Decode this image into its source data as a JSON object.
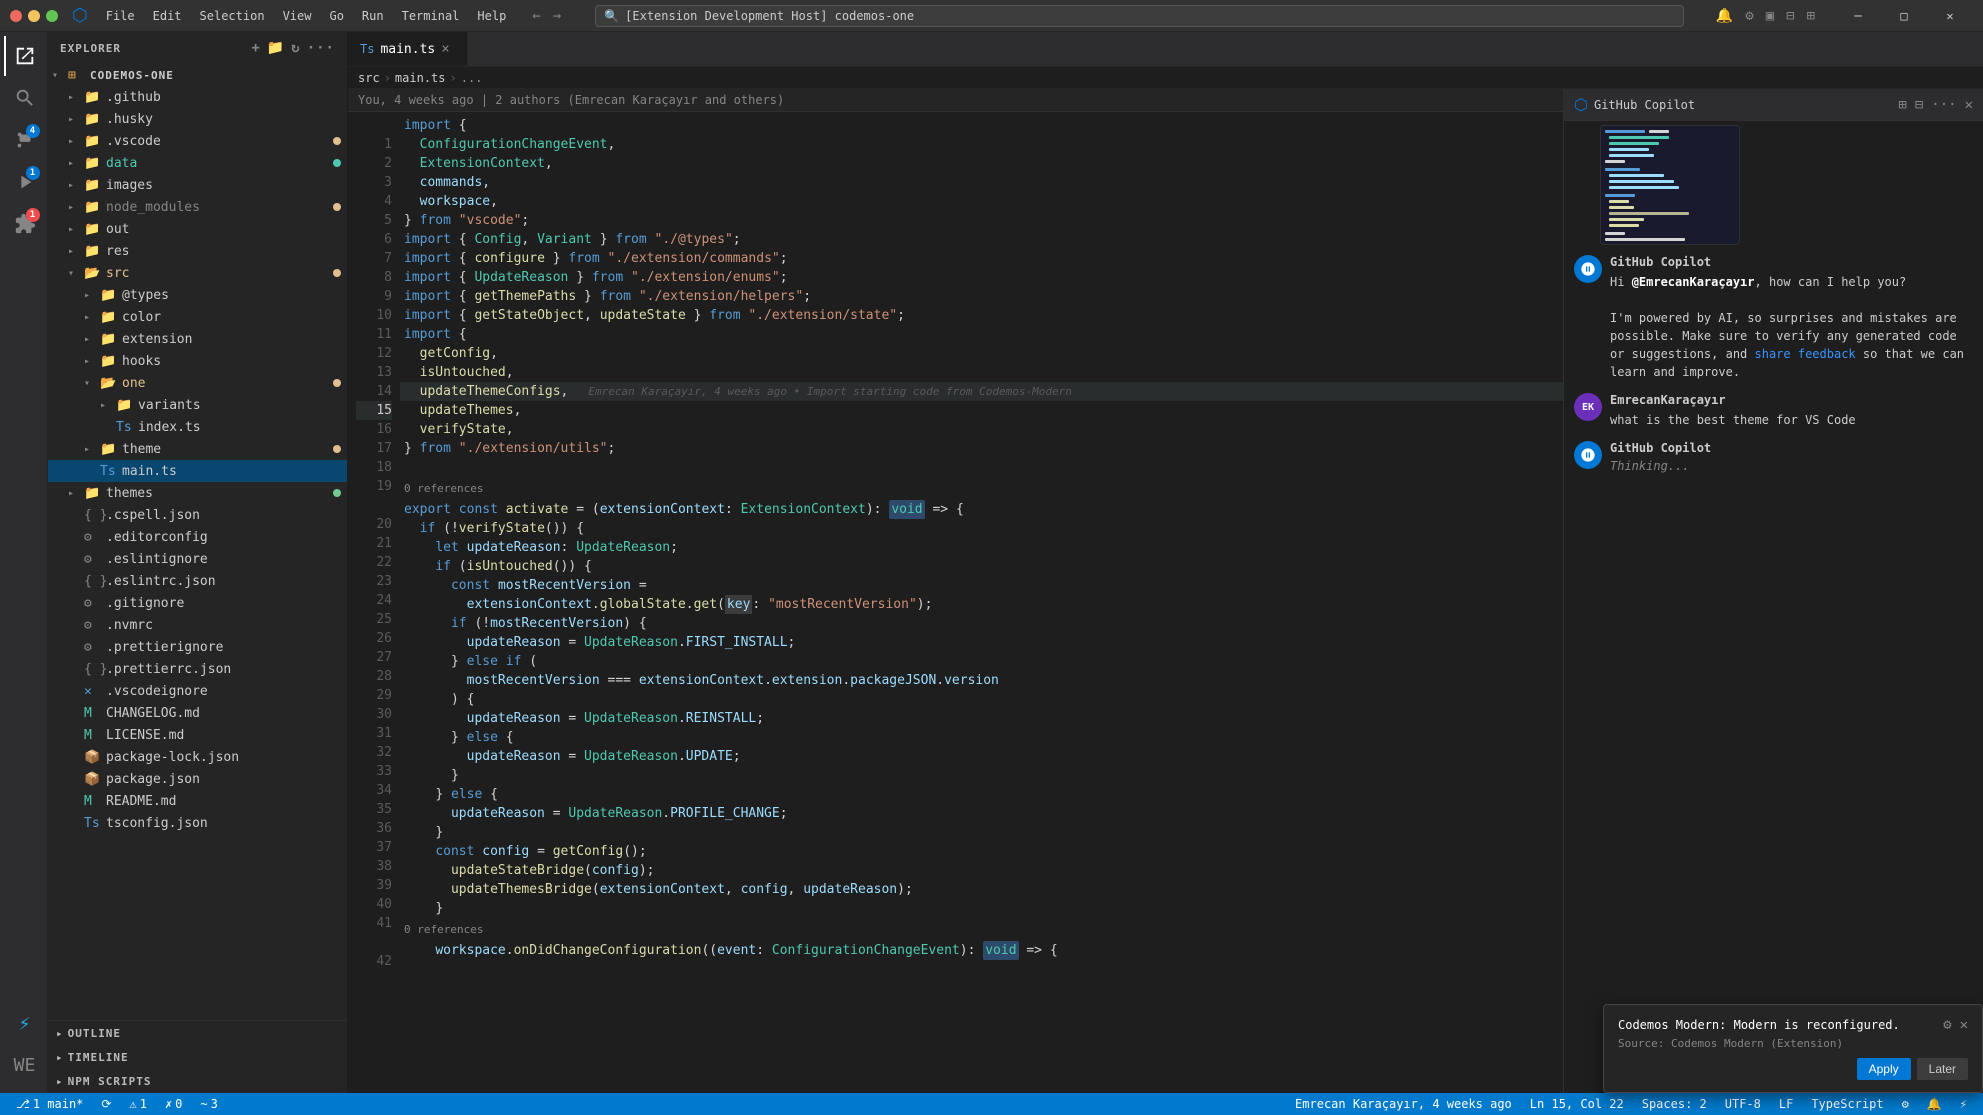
{
  "titleBar": {
    "searchText": "[Extension Development Host] codemos-one",
    "menuItems": [
      "File",
      "Edit",
      "Selection",
      "View",
      "Go",
      "Run",
      "Terminal",
      "Help"
    ]
  },
  "sidebar": {
    "title": "EXPLORER",
    "projectName": "CODEMOS-ONE",
    "headerIcons": [
      "...",
      "☰"
    ],
    "items": [
      {
        "label": ".github",
        "type": "folder",
        "icon": "📁",
        "indent": 1
      },
      {
        "label": ".husky",
        "type": "folder",
        "icon": "📁",
        "indent": 1
      },
      {
        "label": ".vscode",
        "type": "folder",
        "icon": "📁",
        "indent": 1,
        "dot": "yellow"
      },
      {
        "label": "data",
        "type": "folder",
        "icon": "📁",
        "indent": 1,
        "dot": "blue",
        "color": "#4ec9b0"
      },
      {
        "label": "images",
        "type": "folder",
        "icon": "📁",
        "indent": 1
      },
      {
        "label": "node_modules",
        "type": "folder",
        "icon": "📁",
        "indent": 1,
        "dot": "yellow"
      },
      {
        "label": "out",
        "type": "folder",
        "icon": "📁",
        "indent": 1
      },
      {
        "label": "res",
        "type": "folder",
        "icon": "📁",
        "indent": 1
      },
      {
        "label": "src",
        "type": "folder",
        "icon": "📁",
        "indent": 1,
        "dot": "yellow",
        "open": true
      },
      {
        "label": "@types",
        "type": "folder",
        "icon": "📁",
        "indent": 2
      },
      {
        "label": "color",
        "type": "folder",
        "icon": "📁",
        "indent": 2
      },
      {
        "label": "extension",
        "type": "folder",
        "icon": "📁",
        "indent": 2
      },
      {
        "label": "hooks",
        "type": "folder",
        "icon": "📁",
        "indent": 2
      },
      {
        "label": "one",
        "type": "folder",
        "icon": "📁",
        "indent": 2,
        "dot": "yellow",
        "open": true
      },
      {
        "label": "variants",
        "type": "folder",
        "icon": "📁",
        "indent": 3
      },
      {
        "label": "index.ts",
        "type": "file",
        "icon": "🟦",
        "indent": 3
      },
      {
        "label": "theme",
        "type": "folder",
        "icon": "📁",
        "indent": 2,
        "dot": "yellow"
      },
      {
        "label": "main.ts",
        "type": "file",
        "icon": "🟦",
        "indent": 2,
        "active": true
      },
      {
        "label": "themes",
        "type": "folder",
        "icon": "📁",
        "indent": 1,
        "dot": "green"
      },
      {
        "label": ".cspell.json",
        "type": "file",
        "icon": "⚙️",
        "indent": 1
      },
      {
        "label": ".editorconfig",
        "type": "file",
        "icon": "⚙️",
        "indent": 1
      },
      {
        "label": ".eslintignore",
        "type": "file",
        "icon": "⚙️",
        "indent": 1
      },
      {
        "label": ".eslintrc.json",
        "type": "file",
        "icon": "⚙️",
        "indent": 1
      },
      {
        "label": ".gitignore",
        "type": "file",
        "icon": "⚙️",
        "indent": 1
      },
      {
        "label": ".nvmrc",
        "type": "file",
        "icon": "⚙️",
        "indent": 1
      },
      {
        "label": ".prettierignore",
        "type": "file",
        "icon": "⚙️",
        "indent": 1
      },
      {
        "label": ".prettierrc.json",
        "type": "file",
        "icon": "⚙️",
        "indent": 1
      },
      {
        "label": "vscodeignore",
        "type": "file",
        "icon": "⚙️",
        "indent": 1
      },
      {
        "label": "CHANGELOG.md",
        "type": "file",
        "icon": "📄",
        "indent": 1
      },
      {
        "label": "LICENSE.md",
        "type": "file",
        "icon": "📄",
        "indent": 1
      },
      {
        "label": "package-lock.json",
        "type": "file",
        "icon": "📦",
        "indent": 1
      },
      {
        "label": "package.json",
        "type": "file",
        "icon": "📦",
        "indent": 1
      },
      {
        "label": "README.md",
        "type": "file",
        "icon": "📄",
        "indent": 1
      },
      {
        "label": "tsconfig.json",
        "type": "file",
        "icon": "⚙️",
        "indent": 1
      }
    ],
    "bottomSections": [
      "OUTLINE",
      "TIMELINE",
      "NPM SCRIPTS"
    ]
  },
  "tabs": [
    {
      "label": "main.ts",
      "active": true,
      "icon": "🟦",
      "modified": false
    }
  ],
  "breadcrumb": [
    "src",
    ">",
    "main.ts",
    ">",
    "..."
  ],
  "git": {
    "blame": "Emrecan Karaçayır, 4 weeks ago • Import starting code from Codemos-Modern"
  },
  "codeLines": [
    {
      "num": "",
      "content": "You, 4 weeks ago | 2 authors (Emrecan Karaçayır and others)",
      "type": "blame"
    },
    {
      "num": "1",
      "content": "import {"
    },
    {
      "num": "2",
      "content": "  ConfigurationChangeEvent,"
    },
    {
      "num": "3",
      "content": "  ExtensionContext,"
    },
    {
      "num": "4",
      "content": "  commands,"
    },
    {
      "num": "5",
      "content": "  workspace,"
    },
    {
      "num": "6",
      "content": "} from \"vscode\";"
    },
    {
      "num": "7",
      "content": "import { Config, Variant } from \"./@types\";"
    },
    {
      "num": "8",
      "content": "import { configure } from \"./extension/commands\";"
    },
    {
      "num": "9",
      "content": "import { UpdateReason } from \"./extension/enums\";"
    },
    {
      "num": "10",
      "content": "import { getThemePaths } from \"./extension/helpers\";"
    },
    {
      "num": "11",
      "content": "import { getStateObject, updateState } from \"./extension/state\";"
    },
    {
      "num": "12",
      "content": "import {"
    },
    {
      "num": "13",
      "content": "  getConfig,"
    },
    {
      "num": "14",
      "content": "  isUntouched,"
    },
    {
      "num": "15",
      "content": "  updateThemeConfigs,",
      "active": true,
      "blame": "Emrecan Karaçayır, 4 weeks ago • Import starting code from Codemos-Modern"
    },
    {
      "num": "16",
      "content": "  updateThemes,"
    },
    {
      "num": "17",
      "content": "  verifyState,"
    },
    {
      "num": "18",
      "content": "} from \"./extension/utils\";"
    },
    {
      "num": "19",
      "content": ""
    },
    {
      "num": "",
      "content": "0 references",
      "type": "ref"
    },
    {
      "num": "20",
      "content": "export const activate = (extensionContext: ExtensionContext): void => {"
    },
    {
      "num": "21",
      "content": "  if (!verifyState()) {"
    },
    {
      "num": "22",
      "content": "    let updateReason: UpdateReason;"
    },
    {
      "num": "23",
      "content": "    if (isUntouched()) {"
    },
    {
      "num": "24",
      "content": "      const mostRecentVersion ="
    },
    {
      "num": "25",
      "content": "        extensionContext.globalState.get(key: \"mostRecentVersion\");"
    },
    {
      "num": "26",
      "content": "      if (!mostRecentVersion) {"
    },
    {
      "num": "27",
      "content": "        updateReason = UpdateReason.FIRST_INSTALL;"
    },
    {
      "num": "28",
      "content": "      } else if ("
    },
    {
      "num": "29",
      "content": "        mostRecentVersion === extensionContext.extension.packageJSON.version"
    },
    {
      "num": "30",
      "content": "      ) {"
    },
    {
      "num": "31",
      "content": "        updateReason = UpdateReason.REINSTALL;"
    },
    {
      "num": "32",
      "content": "      } else {"
    },
    {
      "num": "33",
      "content": "        updateReason = UpdateReason.UPDATE;"
    },
    {
      "num": "34",
      "content": "      }"
    },
    {
      "num": "35",
      "content": "    } else {"
    },
    {
      "num": "36",
      "content": "      updateReason = UpdateReason.PROFILE_CHANGE;"
    },
    {
      "num": "37",
      "content": "    }"
    },
    {
      "num": "38",
      "content": "    const config = getConfig();"
    },
    {
      "num": "39",
      "content": "      updateStateBridge(config);"
    },
    {
      "num": "40",
      "content": "      updateThemesBridge(extensionContext, config, updateReason);"
    },
    {
      "num": "41",
      "content": "    }"
    },
    {
      "num": "",
      "content": "0 references",
      "type": "ref"
    },
    {
      "num": "42",
      "content": "    workspace.onDidChangeConfiguration((event: ConfigurationChangeEvent): void => {"
    }
  ],
  "copilot": {
    "title": "GitHub Copilot",
    "messages": [
      {
        "sender": "GitHub Copilot",
        "type": "copilot",
        "text": "Hi @EmrecanKaraçayır, how can I help you?",
        "subtext": "I'm powered by AI, so surprises and mistakes are possible. Make sure to verify any generated code or suggestions, and share feedback so that we can learn and improve."
      },
      {
        "sender": "EmrecanKaraçayır",
        "type": "user",
        "text": "what is the best theme for VS Code"
      },
      {
        "sender": "GitHub Copilot",
        "type": "copilot",
        "text": "Thinking..."
      }
    ]
  },
  "notification": {
    "title": "Codemos Modern: Modern is reconfigured.",
    "source": "Source: Codemos Modern (Extension)",
    "applyLabel": "Apply",
    "laterLabel": "Later"
  },
  "statusBar": {
    "left": [
      {
        "text": "⎇ 1 main*",
        "icon": "git-branch"
      },
      {
        "text": "⟳",
        "icon": "sync"
      },
      {
        "text": "⚠ 1",
        "icon": "warning"
      },
      {
        "text": "✗ 0",
        "icon": "error"
      },
      {
        "text": "≈ 3",
        "icon": "info"
      }
    ],
    "right": [
      {
        "text": "Emrecan Karaçayır, 4 weeks ago"
      },
      {
        "text": "Ln 15, Col 22"
      },
      {
        "text": "Spaces: 2"
      },
      {
        "text": "UTF-8"
      },
      {
        "text": "LF"
      },
      {
        "text": "TypeScript"
      },
      {
        "text": "⚙"
      },
      {
        "text": "🔔"
      },
      {
        "text": "⚡"
      }
    ]
  }
}
